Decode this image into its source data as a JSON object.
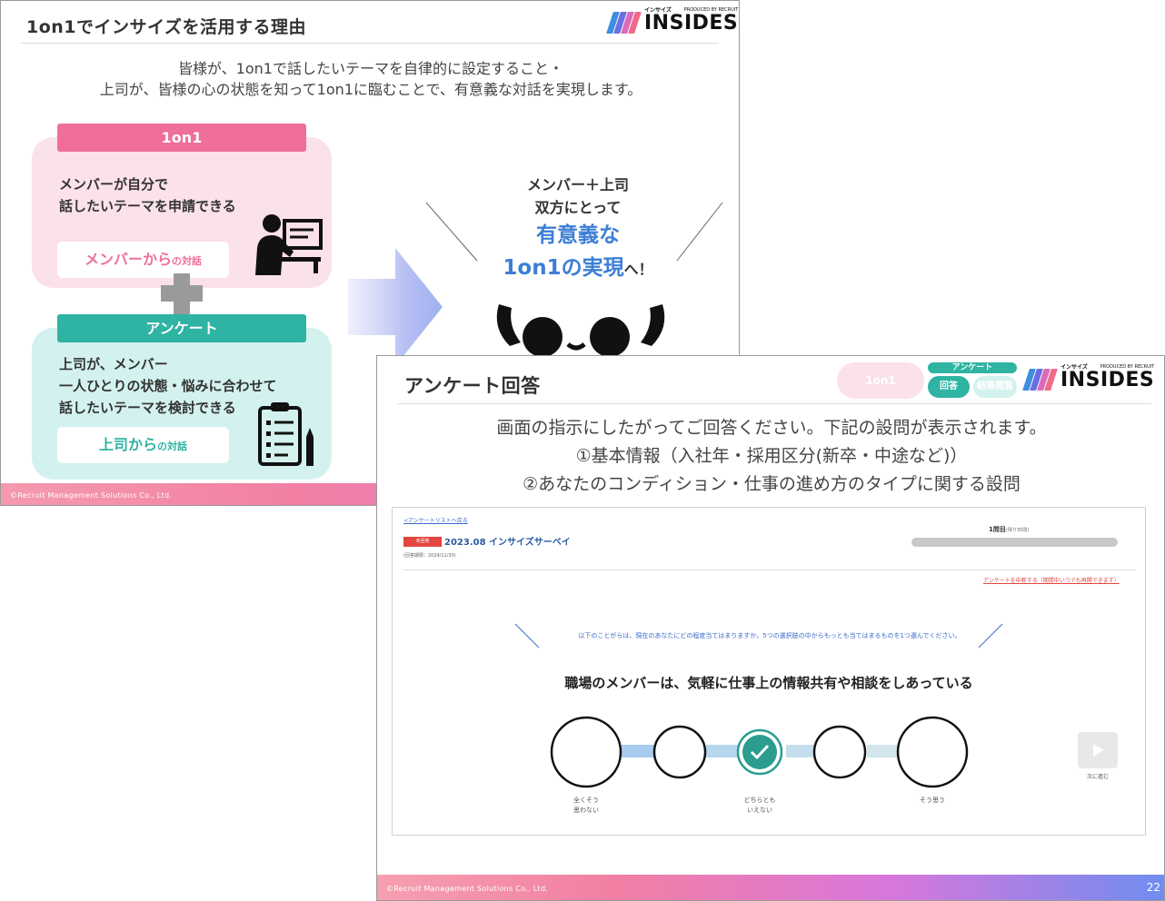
{
  "slide1": {
    "title": "1on1でインサイズを活用する理由",
    "logo": {
      "kana": "インサイズ",
      "sub": "PRODUCED BY RECRUIT",
      "word": "INSIDES"
    },
    "intro": [
      "皆様が、1on1で話したいテーマを自律的に設定すること・",
      "上司が、皆様の心の状態を知って1on1に臨むことで、有意義な対話を実現します。"
    ],
    "card_1on1": {
      "tag": "1on1",
      "text": [
        "メンバーが自分で",
        "話したいテーマを申請できる"
      ],
      "pill_main": "メンバーから",
      "pill_small": "の対話"
    },
    "card_survey": {
      "tag": "アンケート",
      "text": [
        "上司が、メンバー",
        "一人ひとりの状態・悩みに合わせて",
        "話したいテーマを検討できる"
      ],
      "pill_main": "上司から",
      "pill_small": "の対話"
    },
    "right": {
      "line1": "メンバー＋上司",
      "line2": "双方にとって",
      "emph1": "有意義な",
      "emph2": "1on1の実現",
      "tail": "へ！"
    },
    "footer": "©Recruit Management Solutions Co., Ltd.",
    "colors": {
      "pink": "#ef6f98",
      "teal": "#2fb3a2",
      "blue": "#3d7fd6"
    }
  },
  "slide2": {
    "title": "アンケート回答",
    "steps": {
      "one_on_one": "1on1",
      "survey": "アンケート",
      "answer": "回答",
      "result": "結果閲覧"
    },
    "logo": {
      "kana": "インサイズ",
      "sub": "PRODUCED BY RECRUIT",
      "word": "INSIDES"
    },
    "intro": [
      "画面の指示にしたがってご回答ください。下記の設問が表示されます。",
      "①基本情報（入社年・採用区分(新卒・中途など)）",
      "②あなたのコンディション・仕事の進め方のタイプに関する設問"
    ],
    "screen": {
      "back_link": "≺アンケートリストへ戻る",
      "badge": "未回答",
      "survey_title": "2023.08 インサイズサーベイ",
      "deadline": "(回答期限：2024/11/30)",
      "question_count": "1問目",
      "question_remaining": "(残り35問)",
      "progress": 0.03,
      "suspend_link": "アンケートを中断する（期間中いつでも再開できます）",
      "instruction": "以下のことがらは、現在のあなたにどの程度当てはまりますか。5つの選択肢の中からもっとも当てはまるものを1つ選んでください。",
      "question": "職場のメンバーは、気軽に仕事上の情報共有や相談をしあっている",
      "options": [
        {
          "label_l1": "全くそう",
          "label_l2": "思わない"
        },
        {
          "label_l1": "",
          "label_l2": ""
        },
        {
          "label_l1": "どちらとも",
          "label_l2": "いえない"
        },
        {
          "label_l1": "",
          "label_l2": ""
        },
        {
          "label_l1": "そう思う",
          "label_l2": ""
        }
      ],
      "selected_option": 3,
      "next_label": "次に進む"
    },
    "footer": "©Recruit Management Solutions Co., Ltd.",
    "page_number": "22"
  }
}
